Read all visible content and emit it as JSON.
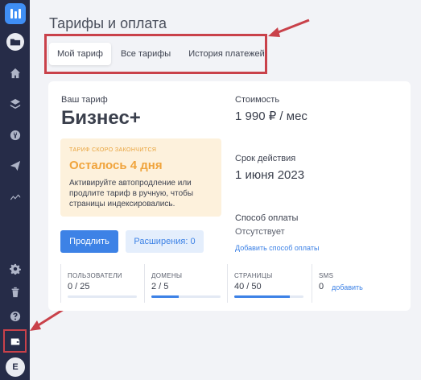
{
  "header": {
    "title": "Тарифы и оплата"
  },
  "tabs": [
    {
      "label": "Мой тариф",
      "active": true
    },
    {
      "label": "Все тарифы",
      "active": false
    },
    {
      "label": "История платежей",
      "active": false
    }
  ],
  "sidebar": {
    "icons": [
      "logo-icon",
      "folder-icon",
      "home-icon",
      "layers-icon",
      "plugin-icon",
      "send-icon",
      "analytics-icon",
      "gear-icon",
      "trash-icon",
      "help-icon",
      "wallet-icon"
    ],
    "avatar_letter": "E"
  },
  "plan": {
    "label": "Ваш тариф",
    "name": "Бизнес+",
    "notice": {
      "tag": "ТАРИФ СКОРО ЗАКОНЧИТСЯ",
      "title": "Осталось 4 дня",
      "text": "Активируйте автопродление или продлите тариф в ручную, чтобы страницы индексировались."
    },
    "extend_button": "Продлить",
    "extensions_button": "Расширения: 0",
    "cost_label": "Стоимость",
    "cost_value": "1 990 ₽ / мес",
    "validity_label": "Срок действия",
    "validity_value": "1 июня 2023",
    "payment_label": "Способ оплаты",
    "payment_value": "Отсутствует",
    "add_payment_link": "Добавить способ оплаты"
  },
  "stats": [
    {
      "label": "ПОЛЬЗОВАТЕЛИ",
      "value": "0 / 25",
      "fill": 0.0
    },
    {
      "label": "ДОМЕНЫ",
      "value": "2 / 5",
      "fill": 0.4
    },
    {
      "label": "СТРАНИЦЫ",
      "value": "40 / 50",
      "fill": 0.8
    },
    {
      "label": "SMS",
      "value": "0",
      "link": "добавить"
    }
  ],
  "colors": {
    "sidebar": "#262c48",
    "accent": "#3d82e6",
    "highlight": "#c9414a",
    "warning": "#f0a43c"
  }
}
